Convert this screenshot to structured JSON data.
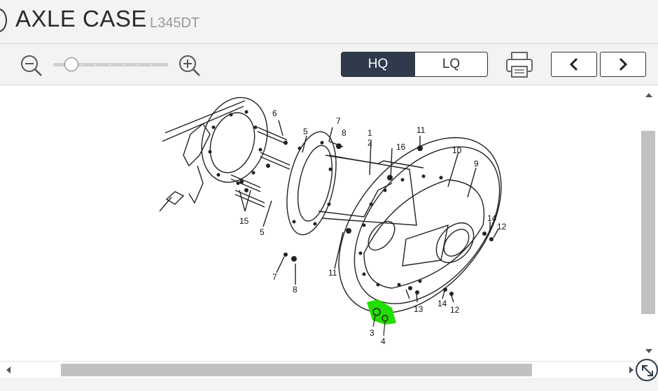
{
  "header": {
    "title": "AXLE CASE",
    "model": "L345DT"
  },
  "toolbar": {
    "quality_options": [
      "HQ",
      "LQ"
    ],
    "selected_quality": "HQ",
    "zoom_level": 0.1
  },
  "diagram": {
    "part_labels": [
      "1",
      "2",
      "3",
      "4",
      "5",
      "5",
      "6",
      "7",
      "7",
      "8",
      "8",
      "9",
      "10",
      "11",
      "11",
      "12",
      "12",
      "13",
      "14",
      "14",
      "15",
      "16"
    ],
    "highlighted_part": "3",
    "highlight_color": "#22dd00"
  },
  "colors": {
    "accent": "#2f3b4d",
    "scrollbar": "#c1c1c1"
  }
}
